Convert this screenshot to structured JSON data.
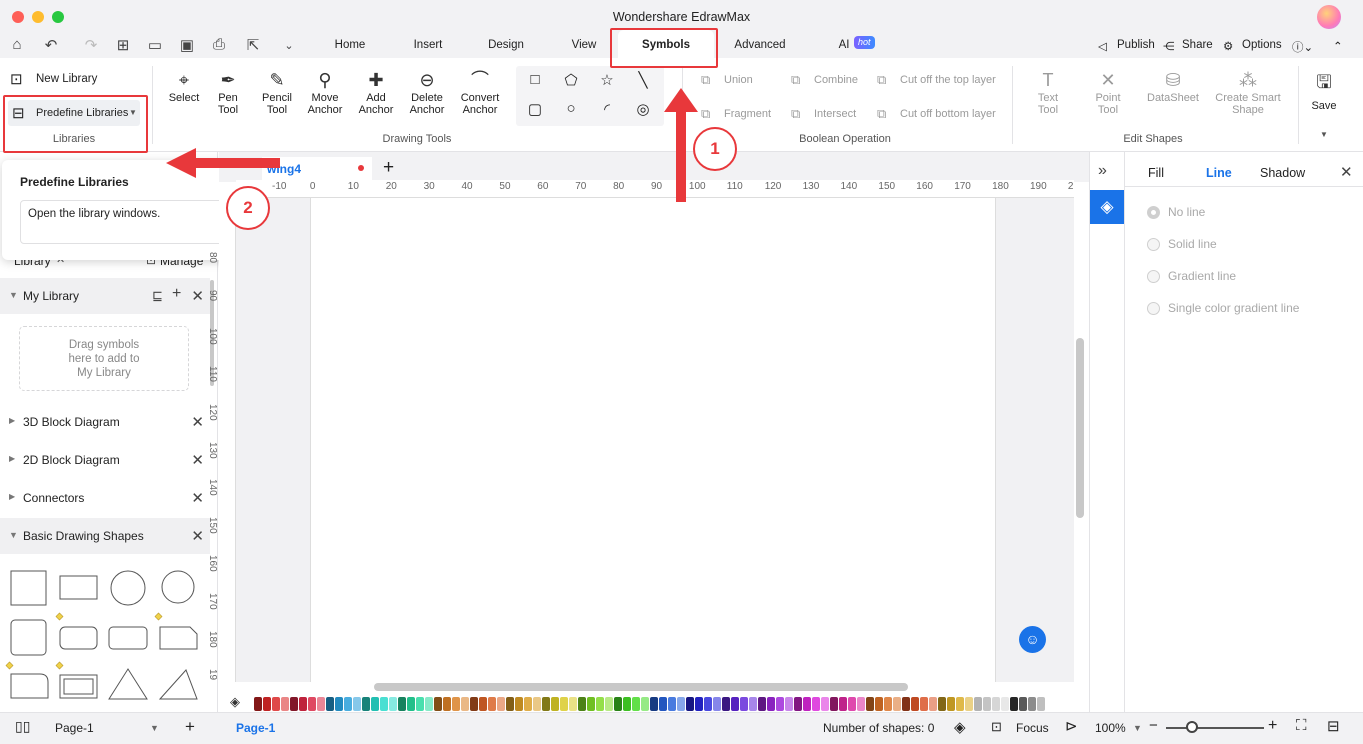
{
  "window": {
    "title": "Wondershare EdrawMax"
  },
  "menu": {
    "tabs": [
      "Home",
      "Insert",
      "Design",
      "View",
      "Symbols",
      "Advanced",
      "AI"
    ],
    "ai_badge": "hot",
    "right": {
      "publish": "Publish",
      "share": "Share",
      "options": "Options"
    }
  },
  "ribbon": {
    "libraries": {
      "new_library": "New Library",
      "predefine": "Predefine Libraries",
      "group": "Libraries"
    },
    "tools": {
      "select": "Select",
      "pen": [
        "Pen",
        "Tool"
      ],
      "pencil": [
        "Pencil",
        "Tool"
      ],
      "move_anchor": [
        "Move",
        "Anchor"
      ],
      "add_anchor": [
        "Add",
        "Anchor"
      ],
      "delete_anchor": [
        "Delete",
        "Anchor"
      ],
      "convert_anchor": [
        "Convert",
        "Anchor"
      ],
      "group": "Drawing Tools"
    },
    "boolean": {
      "union": "Union",
      "combine": "Combine",
      "cut_top": "Cut off the top layer",
      "fragment": "Fragment",
      "intersect": "Intersect",
      "cut_bottom": "Cut off bottom layer",
      "group": "Boolean Operation"
    },
    "edit": {
      "text_tool": [
        "Text",
        "Tool"
      ],
      "point_tool": [
        "Point",
        "Tool"
      ],
      "datasheet": "DataSheet",
      "smart_shape": [
        "Create Smart",
        "Shape"
      ],
      "group": "Edit Shapes"
    },
    "save": "Save"
  },
  "tooltip": {
    "title": "Predefine Libraries",
    "body": "Open the library windows."
  },
  "left_panel": {
    "library_label": "Library",
    "manage": "Manage",
    "my_library": "My Library",
    "drag_hint": [
      "Drag symbols",
      "here to add to",
      "My Library"
    ],
    "libraries": [
      "3D Block Diagram",
      "2D Block Diagram",
      "Connectors",
      "Basic Drawing Shapes"
    ]
  },
  "canvas": {
    "doc_tab": "wing4",
    "h_ticks": [
      "-10",
      "0",
      "10",
      "20",
      "30",
      "40",
      "50",
      "60",
      "70",
      "80",
      "90",
      "100",
      "110",
      "120",
      "130",
      "140",
      "150",
      "160",
      "170",
      "180",
      "190",
      "2"
    ],
    "v_ticks": [
      "80",
      "90",
      "100",
      "110",
      "120",
      "130",
      "140",
      "150",
      "160",
      "170",
      "180",
      "19"
    ]
  },
  "right_panel": {
    "tabs": [
      "Fill",
      "Line",
      "Shadow"
    ],
    "active_tab": "Line",
    "options": [
      "No line",
      "Solid line",
      "Gradient line",
      "Single color gradient line"
    ]
  },
  "status": {
    "page_select": "Page-1",
    "page_tab": "Page-1",
    "shapes": "Number of shapes: 0",
    "focus": "Focus",
    "zoom": "100%"
  },
  "annotations": {
    "step1": "1",
    "step2": "2"
  },
  "colors": {
    "accent": "#1a73e8",
    "annotation": "#e8383b"
  }
}
